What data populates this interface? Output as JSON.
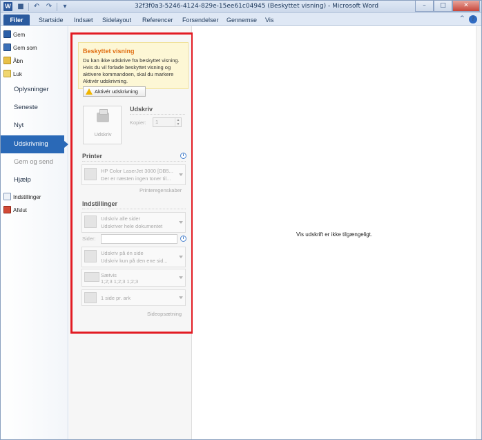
{
  "window": {
    "title": "32f3f0a3-5246-4124-829e-15ee61c04945 (Beskyttet visning) - Microsoft Word",
    "app_icon": "W",
    "minimize": "–",
    "maximize": "□",
    "close": "✕"
  },
  "qat": {
    "save_icon": "■",
    "undo_icon": "↶",
    "redo_icon": "↷",
    "customize_icon": "▾"
  },
  "tabs": [
    "Filer",
    "Startside",
    "Indsæt",
    "Sidelayout",
    "Referencer",
    "Forsendelser",
    "Gennemse",
    "Vis"
  ],
  "tabbar_right": {
    "collapse_icon": "^",
    "help_icon": "?"
  },
  "nav": {
    "commands_top": [
      {
        "label": "Gem",
        "icon": "save-icon"
      },
      {
        "label": "Gem som",
        "icon": "save-as-icon"
      },
      {
        "label": "Åbn",
        "icon": "open-folder-icon"
      },
      {
        "label": "Luk",
        "icon": "close-folder-icon"
      }
    ],
    "tabs": [
      {
        "label": "Oplysninger",
        "state": "normal"
      },
      {
        "label": "Seneste",
        "state": "normal"
      },
      {
        "label": "Nyt",
        "state": "normal"
      },
      {
        "label": "Udskrivning",
        "state": "selected"
      },
      {
        "label": "Gem og send",
        "state": "disabled"
      },
      {
        "label": "Hjælp",
        "state": "normal"
      }
    ],
    "commands_bottom": [
      {
        "label": "Indstillinger",
        "icon": "options-icon"
      },
      {
        "label": "Afslut",
        "icon": "exit-icon"
      }
    ]
  },
  "protected": {
    "title": "Beskyttet visning",
    "text": "Du kan ikke udskrive fra beskyttet visning. Hvis du vil forlade beskyttet visning og aktivere kommandoen, skal du markere Aktivér udskrivning.",
    "button": "Aktivér udskrivning"
  },
  "print": {
    "big_button": "Udskriv",
    "section_title": "Udskriv",
    "copies_label": "Kopier:",
    "copies_value": "1"
  },
  "printer": {
    "section_title": "Printer",
    "name": "HP Color LaserJet 3000 [DB5...",
    "status": "Der er næsten ingen toner til...",
    "properties_link": "Printeregenskaber"
  },
  "settings": {
    "section_title": "Indstillinger",
    "range_line1": "Udskriv alle sider",
    "range_line2": "Udskriver hele dokumentet",
    "pages_label": "Sider:",
    "sides_line1": "Udskriv på én side",
    "sides_line2": "Udskriv kun på den ene sid...",
    "collate_line1": "Sætvis",
    "collate_line2": "1;2;3    1;2;3    1;2;3",
    "per_sheet": "1 side pr. ark",
    "page_setup_link": "Sideopsætning"
  },
  "preview": {
    "message": "Vis udskrift er ikke tilgængeligt."
  },
  "colors": {
    "file_tab": "#2a5a9f",
    "selected_nav": "#2a69b7",
    "highlight_border": "#e21b23",
    "info_title": "#e06d10"
  }
}
